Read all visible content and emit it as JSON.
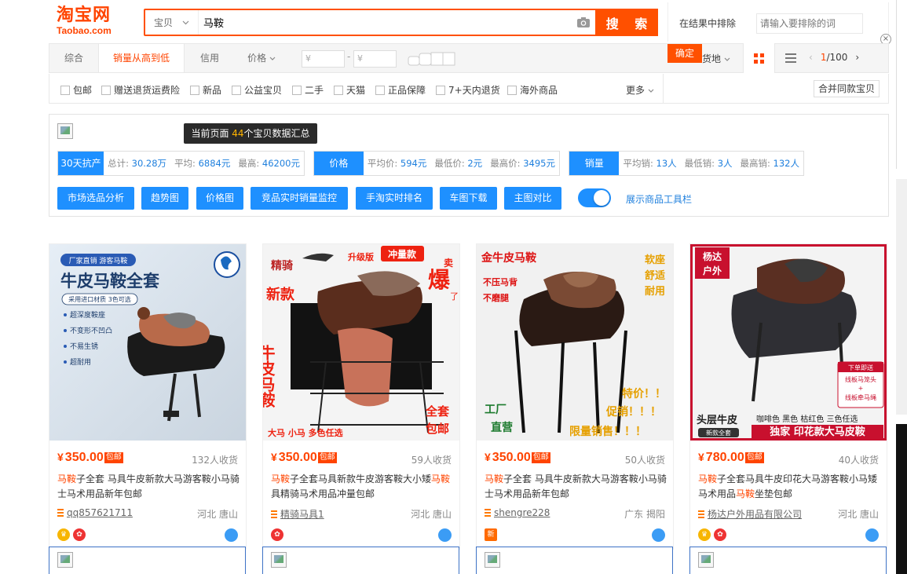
{
  "header": {
    "logo_cn": "淘宝网",
    "logo_en": "Taobao.com",
    "search_category": "宝贝",
    "search_value": "马鞍",
    "search_button": "搜 索",
    "exclude_label": "在结果中排除",
    "exclude_placeholder": "请输入要排除的词"
  },
  "sortbar": {
    "items": [
      "综合",
      "销量从高到低",
      "信用",
      "价格"
    ],
    "price_min_placeholder": "¥",
    "price_max_placeholder": "¥",
    "confirm": "确定",
    "location": "货地",
    "page_current": "1",
    "page_total": "/100"
  },
  "filters": {
    "items": [
      "包邮",
      "赠送退货运费险",
      "新品",
      "公益宝贝",
      "二手",
      "天猫",
      "正品保障",
      "7+天内退货",
      "海外商品"
    ],
    "more": "更多",
    "merge": "合并同款宝贝"
  },
  "tools": {
    "summary_prefix": "当前页面 ",
    "summary_count": "44",
    "summary_suffix": "个宝贝数据汇总",
    "groups": [
      {
        "tag": "30天抗产",
        "stats": [
          [
            "总计:",
            "30.28万"
          ],
          [
            "平均:",
            "6884元"
          ],
          [
            "最高:",
            "46200元"
          ]
        ]
      },
      {
        "tag": "价格",
        "stats": [
          [
            "平均价:",
            "594元"
          ],
          [
            "最低价:",
            "2元"
          ],
          [
            "最高价:",
            "3495元"
          ]
        ]
      },
      {
        "tag": "销量",
        "stats": [
          [
            "平均销:",
            "13人"
          ],
          [
            "最低销:",
            "3人"
          ],
          [
            "最高销:",
            "132人"
          ]
        ]
      }
    ],
    "buttons": [
      "市场选品分析",
      "趋势图",
      "价格图",
      "竞品实时销量监控",
      "手淘实时排名",
      "车图下载",
      "主图对比"
    ],
    "toggle_label": "展示商品工具栏"
  },
  "products": [
    {
      "price": "350.00",
      "post": "包邮",
      "sold": "132人收货",
      "title_hl": "马鞍",
      "title": "子全套 马具牛皮新款大马游客鞍小马骑士马术用品新年包邮",
      "shop": "qq857621711",
      "location": "河北 唐山",
      "img": {
        "tag": "厂家直销 游客马鞍",
        "headline": "牛皮马鞍全套",
        "sub": "采用进口材质 3色可选",
        "bullets": [
          "超深度鞍座",
          "不变形不凹凸",
          "不易生锈",
          "超耐用"
        ]
      }
    },
    {
      "price": "350.00",
      "post": "包邮",
      "sold": "59人收货",
      "title_hl": "马鞍",
      "title": "子全套马具新款牛皮游客鞍大小矮",
      "title_hl2": "马鞍",
      "title2": "具精骑马术用品冲量包邮",
      "shop": "精骑马具1",
      "location": "河北 唐山",
      "img": {
        "brand": "精骑",
        "top1": "升级版",
        "top2": "冲量款",
        "left": "新款",
        "side": "牛皮马鞍",
        "hot": "爆",
        "mai": "卖",
        "le": "了",
        "full": "全套",
        "ship": "包邮",
        "bottom": "大马 小马 多色任选"
      }
    },
    {
      "price": "350.00",
      "post": "包邮",
      "sold": "50人收货",
      "title_hl": "马鞍",
      "title": "子全套 马具牛皮新款大马游客鞍小马骑士马术用品新年包邮",
      "shop": "shengre228",
      "location": "广东 揭阳",
      "img": {
        "headline": "金牛皮马鞍",
        "f1": "不压马背",
        "f2": "不磨腿",
        "r1": "软座",
        "r2": "舒适",
        "r3": "耐用",
        "promo1": "特价！！",
        "promo2": "促销！！！",
        "promo3": "限量销售！！！",
        "factory1": "工厂",
        "factory2": "直营"
      }
    },
    {
      "price": "780.00",
      "post": "包邮",
      "sold": "40人收货",
      "title_hl": "马鞍",
      "title": "子全套马具牛皮印花大马游客鞍小马矮马术用品",
      "title_hl2": "马鞍",
      "title2": "坐垫包邮",
      "shop": "杨达户外用品有限公司",
      "location": "河北 唐山",
      "img": {
        "brand1": "杨达",
        "brand2": "户外",
        "note1": "下单即送",
        "note2": "线板马笼头",
        "note3": "+",
        "note4": "线板牵马绳",
        "leather": "头层牛皮",
        "full": "新款全套",
        "colors": "咖啡色 黑色 枯红色 三色任选",
        "banner": "独家 印花款大马皮鞍"
      }
    }
  ],
  "colors": {
    "accent": "#ff5000",
    "blue": "#1e90ff",
    "price": "#ff4400"
  }
}
